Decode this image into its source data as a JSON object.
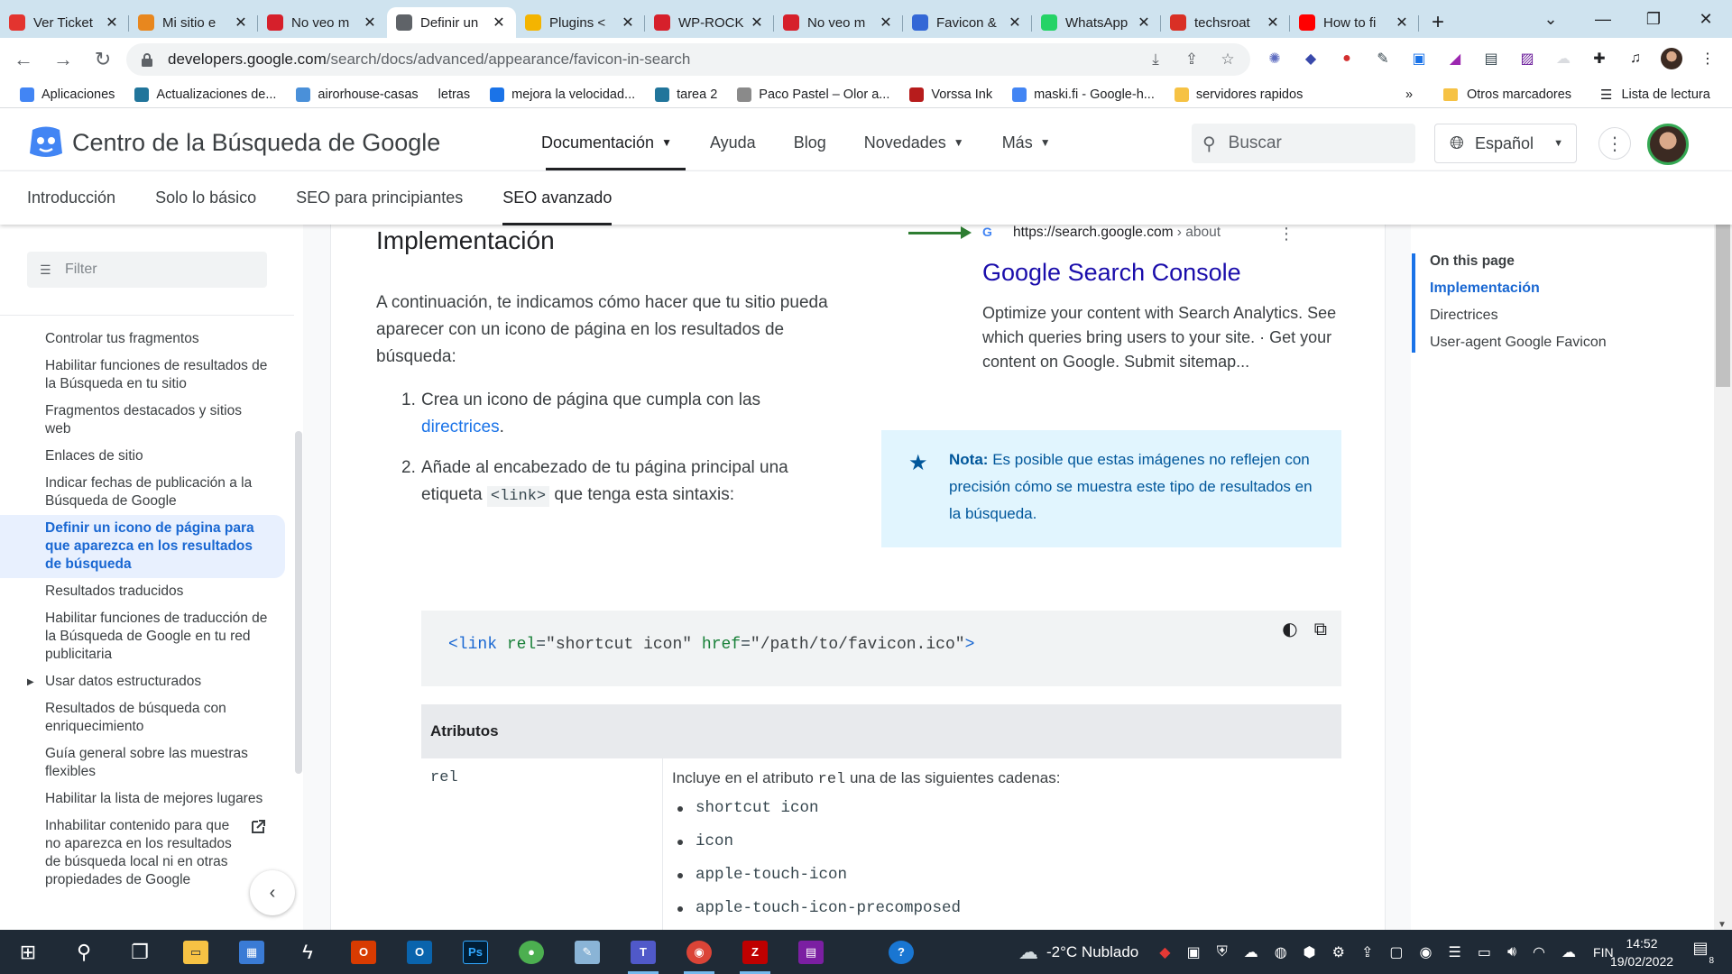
{
  "browser": {
    "tabs": [
      {
        "title": "Ver Ticket",
        "favicon": "wp-rocket-icon",
        "color": "#e3342f",
        "active": false
      },
      {
        "title": "Mi sitio e",
        "favicon": "wp-engine-icon",
        "color": "#e8871e",
        "active": false
      },
      {
        "title": "No veo m",
        "favicon": "wp-rocket-icon",
        "color": "#d6202b",
        "active": false
      },
      {
        "title": "Definir un",
        "favicon": "code-icon",
        "color": "#5f6368",
        "active": true
      },
      {
        "title": "Plugins <",
        "favicon": "plugins-icon",
        "color": "#f4b400",
        "active": false
      },
      {
        "title": "WP-ROCK",
        "favicon": "wp-rocket-icon",
        "color": "#d6202b",
        "active": false
      },
      {
        "title": "No veo m",
        "favicon": "wp-rocket-icon",
        "color": "#d6202b",
        "active": false
      },
      {
        "title": "Favicon &",
        "favicon": "favicon-generator-icon",
        "color": "#3367d6",
        "active": false
      },
      {
        "title": "WhatsApp",
        "favicon": "whatsapp-icon",
        "color": "#25d366",
        "active": false
      },
      {
        "title": "techsroat",
        "favicon": "techsroat-icon",
        "color": "#d93025",
        "active": false
      },
      {
        "title": "How to fi",
        "favicon": "youtube-icon",
        "color": "#ff0000",
        "active": false
      }
    ],
    "url_host": "developers.google.com",
    "url_path": "/search/docs/advanced/appearance/favicon-in-search",
    "bookmarks": [
      {
        "label": "Aplicaciones",
        "icon": "apps-grid-icon",
        "color": "#4285f4"
      },
      {
        "label": "Actualizaciones de...",
        "icon": "wordpress-icon",
        "color": "#21759b"
      },
      {
        "label": "airorhouse-casas",
        "icon": "airorhouse-icon",
        "color": "#4a90d9"
      },
      {
        "label": "letras",
        "icon": "",
        "color": "#ffffff"
      },
      {
        "label": "mejora la velocidad...",
        "icon": "speed-icon",
        "color": "#1a73e8"
      },
      {
        "label": "tarea 2",
        "icon": "wordpress-icon",
        "color": "#21759b"
      },
      {
        "label": "Paco Pastel – Olor a...",
        "icon": "paco-icon",
        "color": "#8a8a8a"
      },
      {
        "label": "Vorssa Ink",
        "icon": "vorssa-icon",
        "color": "#b71c1c"
      },
      {
        "label": "maski.fi - Google-h...",
        "icon": "google-icon",
        "color": "#4285f4"
      },
      {
        "label": "servidores rapidos",
        "icon": "folder-icon",
        "color": "#f6c244"
      }
    ],
    "bookmarks_overflow": "»",
    "other_bookmarks": "Otros marcadores",
    "reading_list": "Lista de lectura"
  },
  "site": {
    "title": "Centro de la Búsqueda de Google",
    "nav": [
      {
        "label": "Documentación",
        "dropdown": true,
        "active": true
      },
      {
        "label": "Ayuda",
        "dropdown": false,
        "active": false
      },
      {
        "label": "Blog",
        "dropdown": false,
        "active": false
      },
      {
        "label": "Novedades",
        "dropdown": true,
        "active": false
      },
      {
        "label": "Más",
        "dropdown": true,
        "active": false
      }
    ],
    "search_placeholder": "Buscar",
    "language": "Español",
    "subnav": [
      "Introducción",
      "Solo lo básico",
      "SEO para principiantes",
      "SEO avanzado"
    ]
  },
  "sidebar": {
    "filter_placeholder": "Filter",
    "items": [
      {
        "label": "Controlar tus fragmentos"
      },
      {
        "label": "Habilitar funciones de resultados de la Búsqueda en tu sitio"
      },
      {
        "label": "Fragmentos destacados y sitios web"
      },
      {
        "label": "Enlaces de sitio"
      },
      {
        "label": "Indicar fechas de publicación a la Búsqueda de Google"
      },
      {
        "label": "Definir un icono de página para que aparezca en los resultados de búsqueda"
      },
      {
        "label": "Resultados traducidos"
      },
      {
        "label": "Habilitar funciones de traducción de la Búsqueda de Google en tu red publicitaria"
      },
      {
        "label": "Usar datos estructurados"
      },
      {
        "label": "Resultados de búsqueda con enriquecimiento"
      },
      {
        "label": "Guía general sobre las muestras flexibles"
      },
      {
        "label": "Habilitar la lista de mejores lugares"
      },
      {
        "label": "Inhabilitar contenido para que no aparezca en los resultados de búsqueda local ni en otras propiedades de Google"
      }
    ]
  },
  "article": {
    "heading": "Implementación",
    "intro": "A continuación, te indicamos cómo hacer que tu sitio pueda aparecer con un icono de página en los resultados de búsqueda:",
    "step1_text": "Crea un icono de página que cumpla con las",
    "step1_link": "directrices",
    "step1_end": ".",
    "step2_text": "Añade al encabezado de tu página principal una etiqueta",
    "step2_code": "<link>",
    "step2_end": "que tenga esta sintaxis:",
    "serp": {
      "g": "G",
      "url": "https://search.google.com",
      "crumb": " › about",
      "title": "Google Search Console",
      "desc": "Optimize your content with Search Analytics. See which queries bring users to your site. · Get your content on Google. Submit sitemap..."
    },
    "note_label": "Nota:",
    "note_text": "Es posible que estas imágenes no reflejen con precisión cómo se muestra este tipo de resultados en la búsqueda.",
    "code": {
      "open": "<link",
      "attr1": "rel",
      "val1": "\"shortcut icon\"",
      "attr2": "href",
      "val2": "\"/path/to/favicon.ico\"",
      "close": ">"
    },
    "table_header": "Atributos",
    "rel_name": "rel",
    "rel_desc_a": "Incluye en el atributo",
    "rel_desc_code": "rel",
    "rel_desc_b": "una de las siguientes cadenas:",
    "rel_values": [
      "shortcut icon",
      "icon",
      "apple-touch-icon",
      "apple-touch-icon-precomposed"
    ]
  },
  "toc": {
    "title": "On this page",
    "links": [
      "Implementación",
      "Directrices",
      "User-agent Google Favicon"
    ]
  },
  "taskbar": {
    "weather": "-2°C  Nublado",
    "lang": "FIN",
    "time": "14:52",
    "date": "19/02/2022",
    "notifications": "8"
  }
}
